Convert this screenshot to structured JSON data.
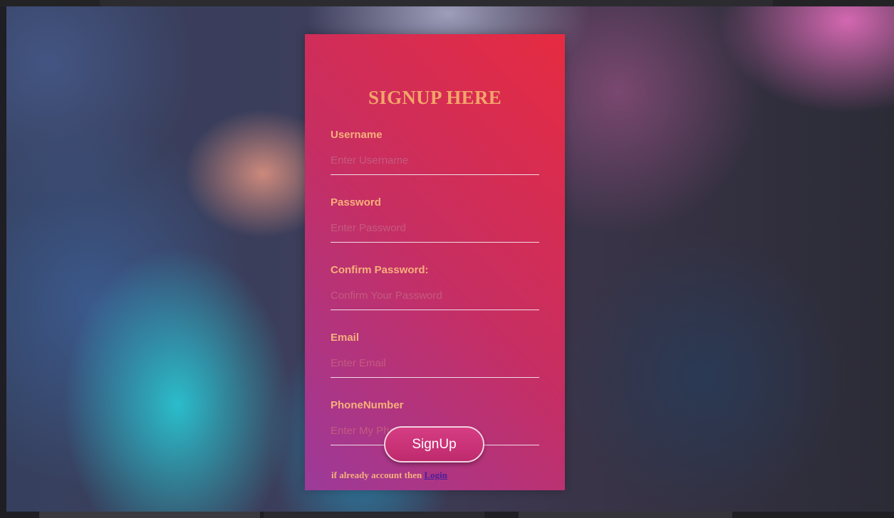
{
  "form": {
    "title": "SIGNUP HERE",
    "fields": [
      {
        "label": "Username",
        "placeholder": "Enter Username",
        "value": ""
      },
      {
        "label": "Password",
        "placeholder": "Enter Password",
        "value": ""
      },
      {
        "label": "Confirm Password:",
        "placeholder": "Confirm Your Password",
        "value": ""
      },
      {
        "label": "Email",
        "placeholder": "Enter Email",
        "value": ""
      },
      {
        "label": "PhoneNumber",
        "placeholder": "Enter My Phone Number",
        "value": ""
      }
    ],
    "submit_label": "SignUp",
    "footer_text": "if already account then ",
    "login_link": "Login"
  },
  "colors": {
    "card_gradient": [
      "#e62b41",
      "#c72e62",
      "#9c3a9a"
    ],
    "label": "#f7b07c",
    "title": "#f4a56a",
    "link": "#4a1e9b"
  }
}
